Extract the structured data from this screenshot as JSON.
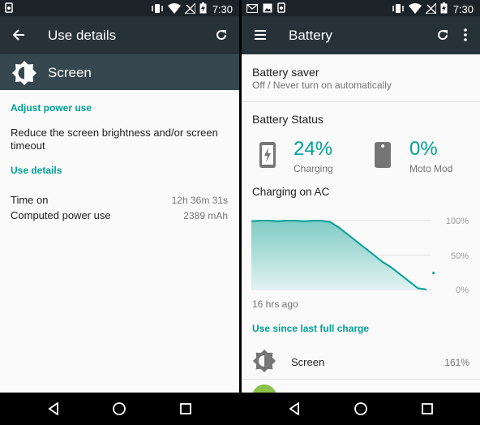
{
  "left": {
    "status": {
      "time": "7:30"
    },
    "appbar": {
      "title": "Use details"
    },
    "header": {
      "title": "Screen"
    },
    "adjust_power_use": "Adjust power use",
    "suggestion": "Reduce the screen brightness and/or screen timeout",
    "use_details": "Use details",
    "rows": [
      {
        "label": "Time on",
        "value": "12h 36m 31s"
      },
      {
        "label": "Computed power use",
        "value": "2389 mAh"
      }
    ]
  },
  "right": {
    "status": {
      "time": "7:30"
    },
    "appbar": {
      "title": "Battery"
    },
    "battery_saver": {
      "title": "Battery saver",
      "subtitle": "Off / Never turn on automatically"
    },
    "battery_status_title": "Battery Status",
    "phone_battery": {
      "percent": "24%",
      "label": "Charging"
    },
    "moto_mod": {
      "percent": "0%",
      "label": "Moto Mod"
    },
    "charging_title": "Charging on AC",
    "chart_data": {
      "type": "area",
      "y_ticks": [
        "100%",
        "50%",
        "0%"
      ],
      "ylim": [
        0,
        100
      ],
      "x_start_label": "16 hrs ago",
      "x": [
        0,
        0.05,
        0.1,
        0.15,
        0.2,
        0.25,
        0.3,
        0.35,
        0.4,
        0.42,
        0.45,
        0.5,
        0.55,
        0.6,
        0.65,
        0.7,
        0.75,
        0.8,
        0.85,
        0.9,
        0.95,
        1.0
      ],
      "values": [
        99,
        100,
        100,
        99,
        100,
        100,
        99,
        100,
        100,
        99,
        98,
        90,
        80,
        70,
        60,
        50,
        40,
        32,
        22,
        12,
        2,
        0
      ],
      "projection_point": {
        "x": 1.04,
        "y": 24
      },
      "colors": {
        "line": "#00a096",
        "fill": "#b2dfdb"
      }
    },
    "use_since": "Use since last full charge",
    "usage_items": [
      {
        "label": "Screen",
        "value": "161%"
      }
    ]
  }
}
